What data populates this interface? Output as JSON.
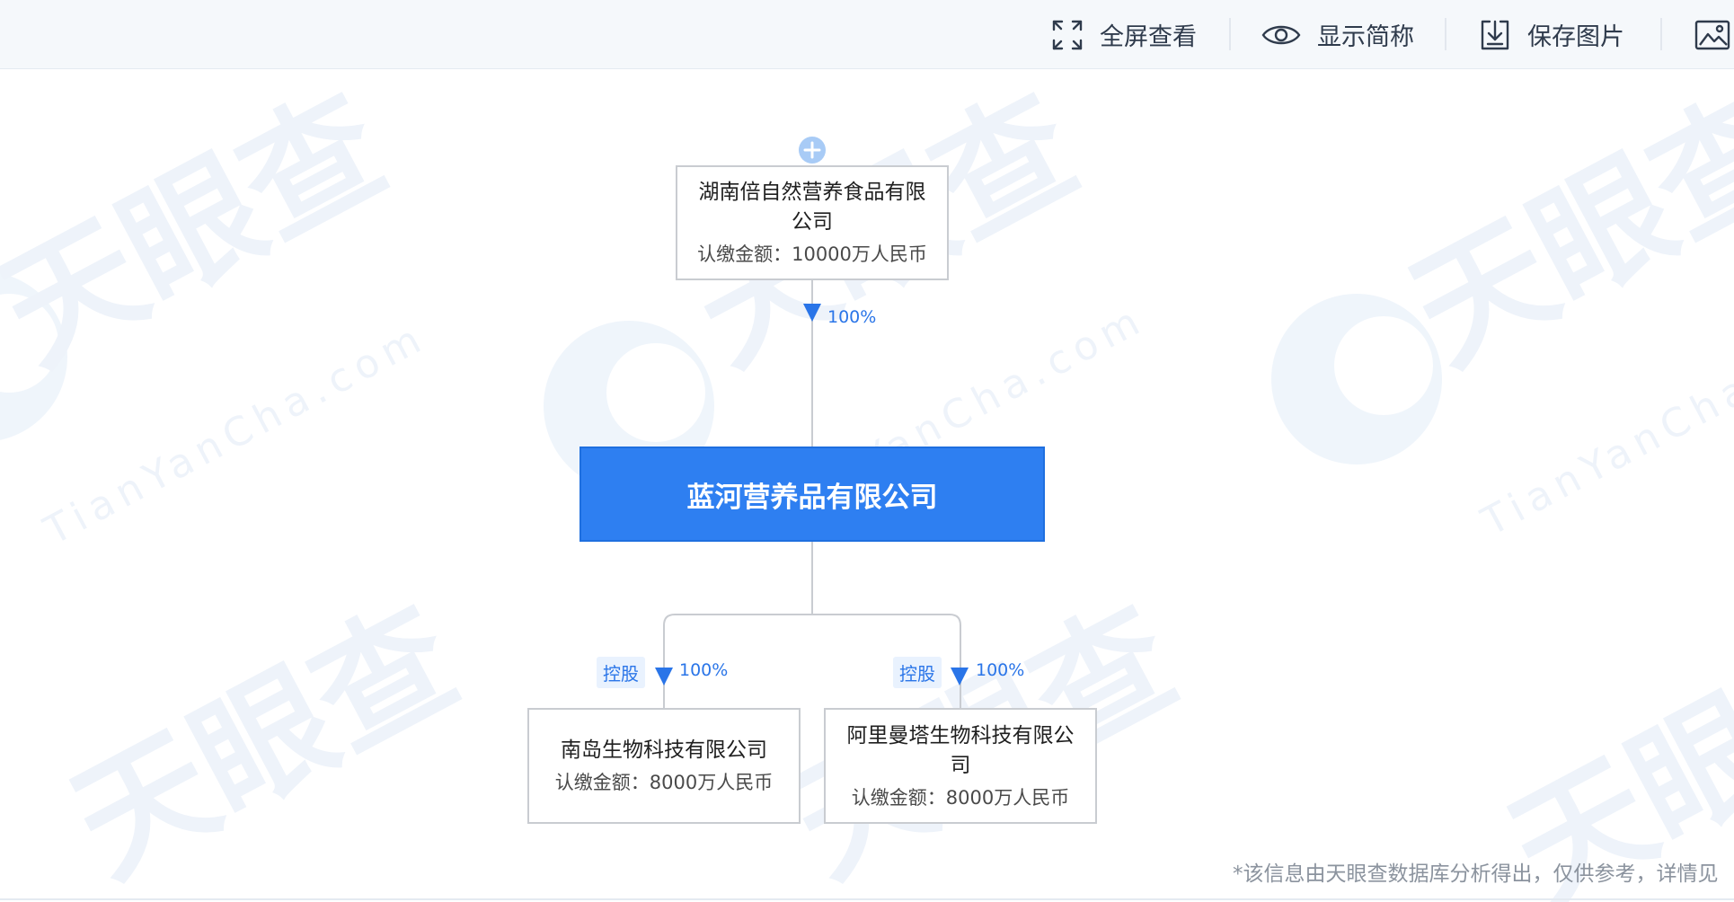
{
  "toolbar": {
    "fullscreen_label": "全屏查看",
    "show_abbr_label": "显示简称",
    "save_image_label": "保存图片"
  },
  "watermark": {
    "cn": "天眼查",
    "en": "TianYanCha.com"
  },
  "diagram": {
    "top_holder": {
      "name": "湖南倍自然营养食品有限公司",
      "amount": "认缴金额：10000万人民币",
      "ratio": "100%"
    },
    "main_company": {
      "name": "蓝河营养品有限公司"
    },
    "subsidiaries": [
      {
        "name": "南岛生物科技有限公司",
        "amount": "认缴金额：8000万人民币",
        "tag": "控股",
        "ratio": "100%"
      },
      {
        "name": "阿里曼塔生物科技有限公司",
        "amount": "认缴金额：8000万人民币",
        "tag": "控股",
        "ratio": "100%"
      }
    ]
  },
  "disclaimer": "*该信息由天眼查数据库分析得出，仅供参考，详情见",
  "colors": {
    "accent": "#2e7ff1",
    "border": "#c9ccd1",
    "line": "#c9ccd1",
    "toolbar_bg": "#f5f8fb"
  },
  "icons": [
    "expand-icon",
    "eye-icon",
    "download-icon",
    "image-icon",
    "plus-circle-icon",
    "arrow-down-icon"
  ]
}
